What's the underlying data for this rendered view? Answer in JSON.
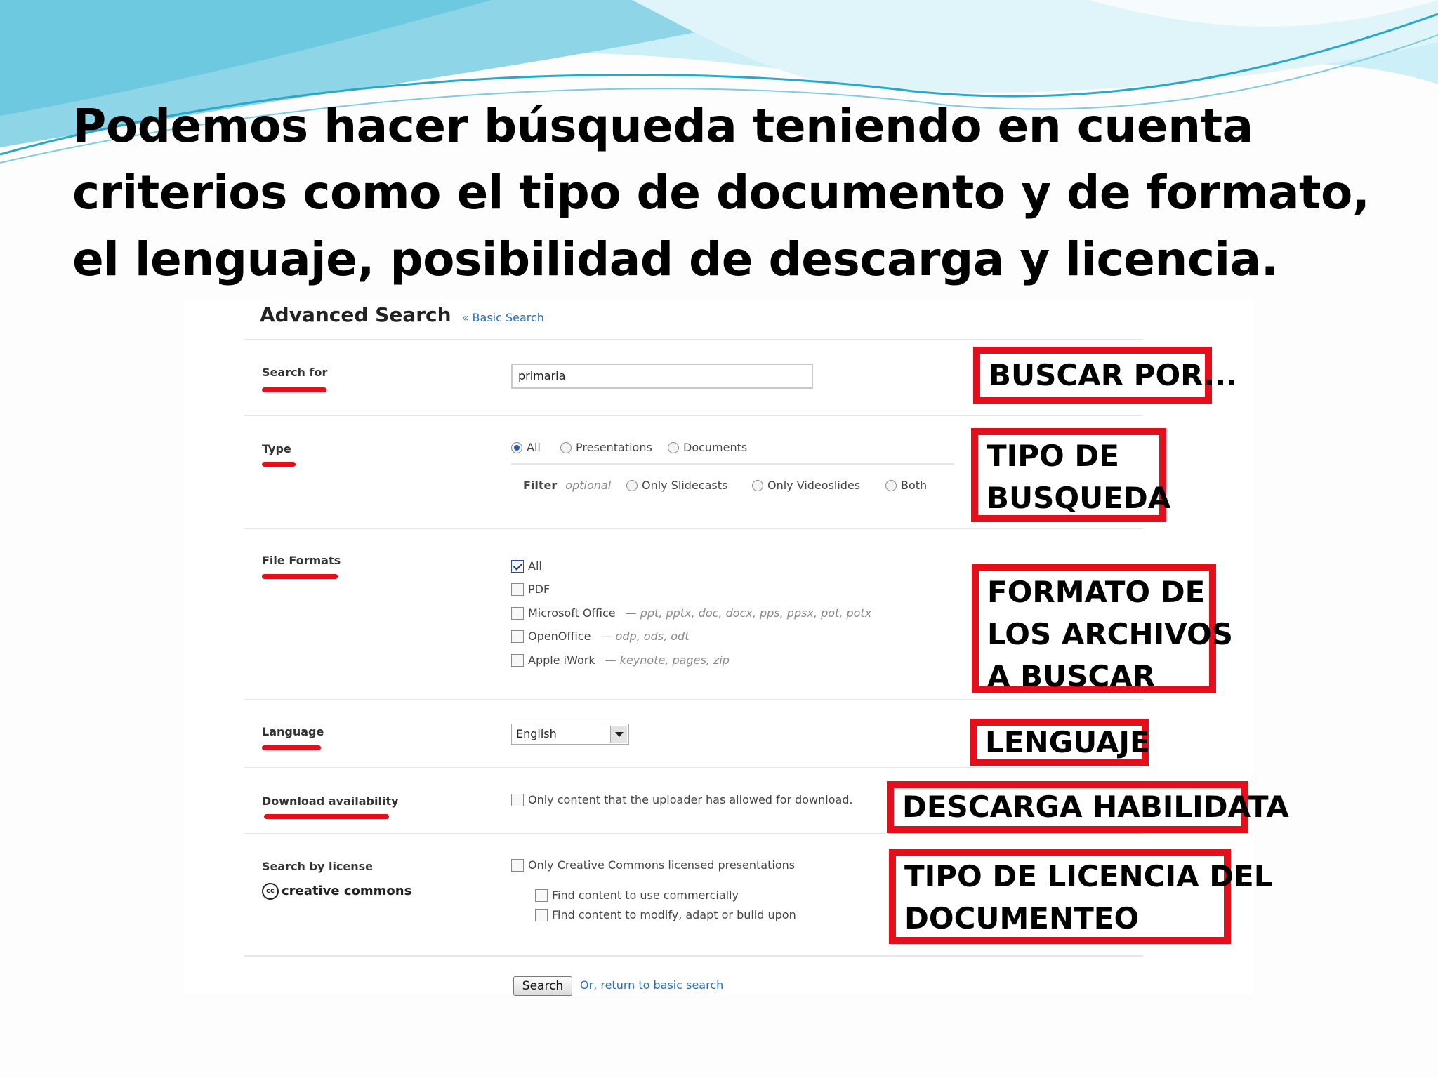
{
  "slide": {
    "title": "Podemos hacer búsqueda teniendo en cuenta criterios como el tipo de documento y de formato, el lenguaje, posibilidad de descarga y licencia."
  },
  "advanced_search": {
    "title": "Advanced Search",
    "basic_link": "« Basic Search",
    "search_for": {
      "label": "Search for",
      "value": "primaria"
    },
    "type": {
      "label": "Type",
      "options": [
        "All",
        "Presentations",
        "Documents"
      ],
      "selected": "All",
      "filter_label": "Filter",
      "filter_hint": "optional",
      "filter_options": [
        "Only Slidecasts",
        "Only Videoslides",
        "Both"
      ]
    },
    "file_formats": {
      "label": "File Formats",
      "items": [
        {
          "label": "All",
          "ext": "",
          "checked": true
        },
        {
          "label": "PDF",
          "ext": "",
          "checked": false
        },
        {
          "label": "Microsoft Office",
          "ext": "— ppt, pptx, doc, docx, pps, ppsx, pot, potx",
          "checked": false
        },
        {
          "label": "OpenOffice",
          "ext": "— odp, ods, odt",
          "checked": false
        },
        {
          "label": "Apple iWork",
          "ext": "— keynote, pages, zip",
          "checked": false
        }
      ]
    },
    "language": {
      "label": "Language",
      "selected": "English"
    },
    "download": {
      "label": "Download availability",
      "option": "Only content that the uploader has allowed for download."
    },
    "license": {
      "label": "Search by license",
      "logo_text": "creative commons",
      "option": "Only Creative Commons licensed presentations",
      "sub_options": [
        "Find content to use commercially",
        "Find content to modify, adapt or build upon"
      ]
    },
    "search_button": "Search",
    "return_link": "Or, return to basic search"
  },
  "annotations": {
    "buscar_por": "BUSCAR POR...",
    "tipo_busqueda": [
      "TIPO DE",
      "BUSQUEDA"
    ],
    "formato": [
      "FORMATO DE",
      "LOS ARCHIVOS",
      "A BUSCAR"
    ],
    "lenguaje": "LENGUAJE",
    "descarga": "DESCARGA HABILIDATA",
    "licencia": [
      "TIPO DE LICENCIA DEL",
      "DOCUMENTEO"
    ],
    "border_color": "#e3101b"
  },
  "colors": {
    "accent": "#e3101b",
    "link": "#2a6ebb",
    "wave_light": "#bfe8f3",
    "wave_dark": "#2aa7c9"
  }
}
